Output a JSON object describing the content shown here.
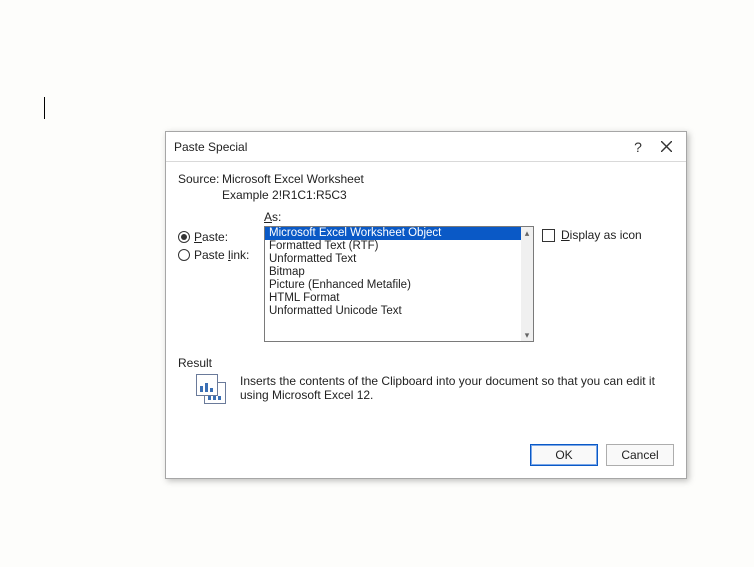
{
  "dialog": {
    "title": "Paste Special",
    "help_symbol": "?",
    "source_label": "Source:",
    "source_value": "Microsoft Excel Worksheet",
    "source_range": "Example 2!R1C1:R5C3",
    "as_label": "As:",
    "radio_paste": "Paste:",
    "radio_paste_underline": "P",
    "radio_pastelink": "Paste link:",
    "radio_pastelink_underline": "l",
    "selected_radio": "paste",
    "list": {
      "items": [
        "Microsoft Excel Worksheet Object",
        "Formatted Text (RTF)",
        "Unformatted Text",
        "Bitmap",
        "Picture (Enhanced Metafile)",
        "HTML Format",
        "Unformatted Unicode Text"
      ],
      "selected_index": 0
    },
    "display_as_icon_label": "Display as icon",
    "display_as_icon_underline": "D",
    "display_as_icon_checked": false,
    "result_label": "Result",
    "result_text": "Inserts the contents of the Clipboard into your document so that you can edit it using Microsoft Excel 12.",
    "ok_label": "OK",
    "cancel_label": "Cancel"
  }
}
